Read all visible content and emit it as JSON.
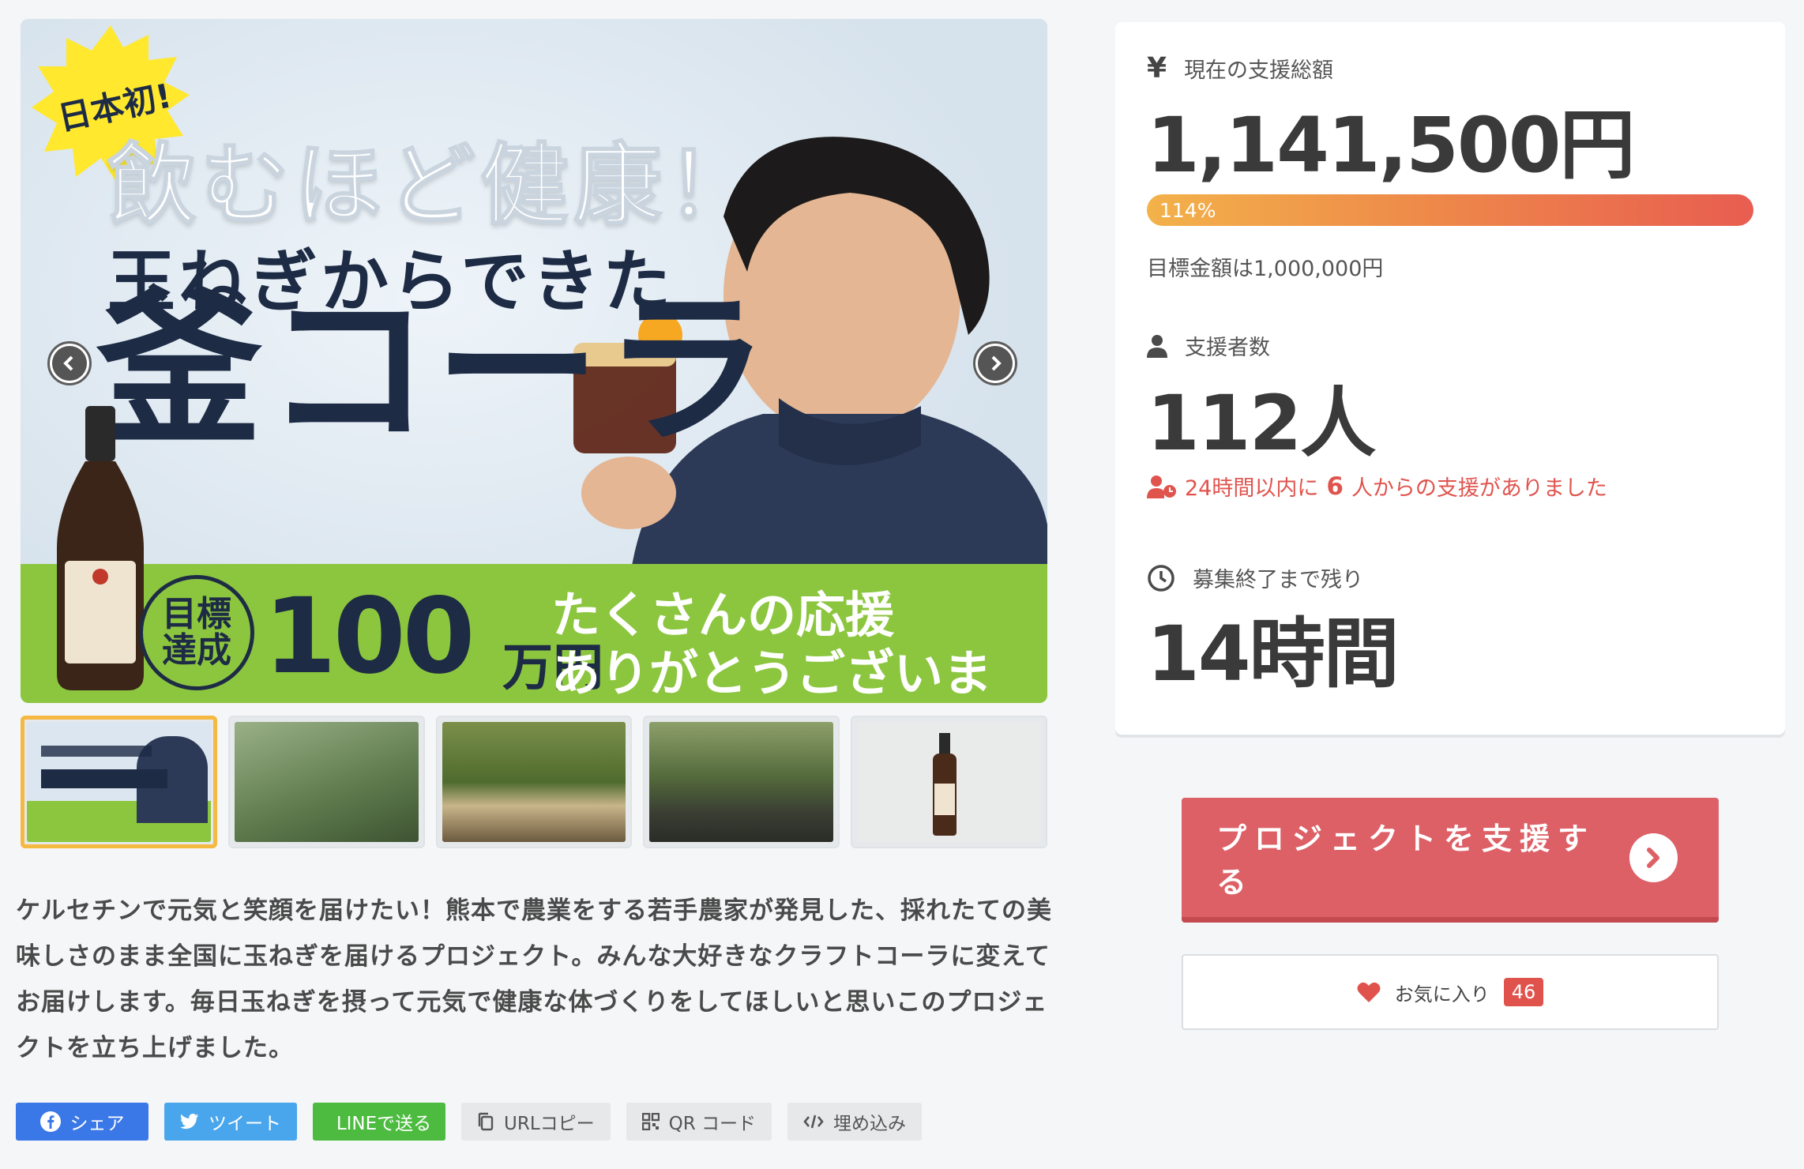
{
  "hero": {
    "badge": "日本初!",
    "headline1": "飲むほど健康！",
    "headline2": "玉ねぎからできた",
    "headline3": "釜コーラ",
    "goal_circle": "目標\n達成",
    "goal_amount": "100",
    "goal_unit": "万円",
    "thanks": "たくさんの応援\nありがとうございます!"
  },
  "thumbnails": [
    {
      "label": "project-main-image"
    },
    {
      "label": "farmer-in-field"
    },
    {
      "label": "harvested-onions"
    },
    {
      "label": "farmers-group"
    },
    {
      "label": "cola-bottle"
    }
  ],
  "description": "ケルセチンで元気と笑顔を届けたい！熊本で農業をする若手農家が発見した、採れたての美味しさのまま全国に玉ねぎを届けるプロジェクト。みんな大好きなクラフトコーラに変えてお届けします。毎日玉ねぎを摂って元気で健康な体づくりをしてほしいと思いこのプロジェクトを立ち上げました。",
  "share": {
    "facebook": "シェア",
    "twitter": "ツイート",
    "line": "LINEで送る",
    "url_copy": "URLコピー",
    "qr": "QR コード",
    "embed": "埋め込み"
  },
  "stats": {
    "amount_label": "現在の支援総額",
    "amount_value": "1,141,500円",
    "progress_text": "114%",
    "progress_fraction": 1.14,
    "goal_note": "目標金額は1,000,000円",
    "supporters_label": "支援者数",
    "supporters_value": "112人",
    "recent_prefix": "24時間以内に",
    "recent_count": "6",
    "recent_suffix": "人からの支援がありました",
    "remaining_label": "募集終了まで残り",
    "remaining_value": "14時間"
  },
  "actions": {
    "support_label": "プロジェクトを支援する",
    "favorite_label": "お気に入り",
    "favorite_count": "46"
  },
  "colors": {
    "accent": "#dd6066",
    "progress_start": "#f3b24a",
    "progress_end": "#e85d50",
    "hero_band": "#8cc63f",
    "navy": "#1d2b45"
  }
}
